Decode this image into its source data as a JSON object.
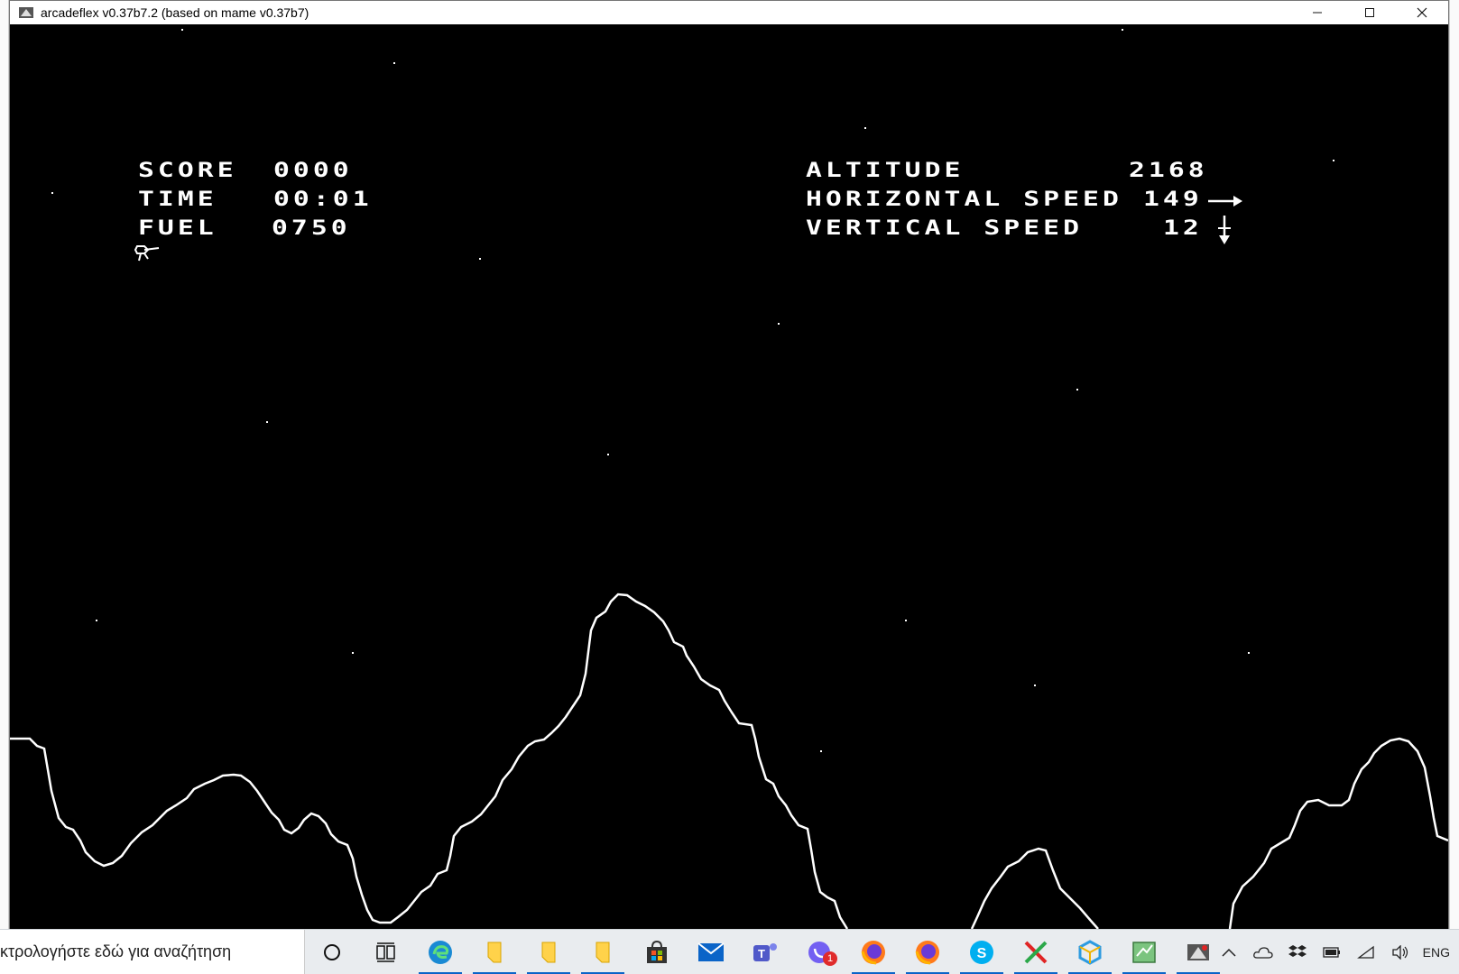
{
  "window": {
    "title": "arcadeflex v0.37b7.2 (based on mame v0.37b7)",
    "controls": [
      "minimize",
      "maximize",
      "close"
    ]
  },
  "hud": {
    "score_label": "SCORE",
    "score_value": "0000",
    "time_label": "TIME",
    "time_value": "00:01",
    "fuel_label": "FUEL",
    "fuel_value": "0750",
    "altitude_label": "ALTITUDE",
    "altitude_value": "2168",
    "hspeed_label": "HORIZONTAL SPEED",
    "hspeed_value": "149",
    "hspeed_direction": "right-arrow-icon",
    "vspeed_label": "VERTICAL SPEED",
    "vspeed_value": "12",
    "vspeed_direction": "down-arrow-icon"
  },
  "taskbar": {
    "search_placeholder": "κτρολογήστε εδώ για αναζήτηση",
    "apps": [
      {
        "name": "cortana-icon"
      },
      {
        "name": "task-view-icon"
      },
      {
        "name": "edge-icon",
        "active": true
      },
      {
        "name": "file-explorer-icon",
        "active": true
      },
      {
        "name": "file-explorer-icon",
        "active": true
      },
      {
        "name": "file-explorer-icon",
        "active": true
      },
      {
        "name": "store-icon"
      },
      {
        "name": "mail-icon"
      },
      {
        "name": "teams-icon"
      },
      {
        "name": "viber-icon",
        "badge": "1"
      },
      {
        "name": "firefox-icon",
        "active": true
      },
      {
        "name": "firefox-icon",
        "active": true
      },
      {
        "name": "skype-icon",
        "active": true
      },
      {
        "name": "xmind-icon",
        "active": true
      },
      {
        "name": "cube-app-icon",
        "active": true
      },
      {
        "name": "notepad-icon",
        "active": true
      },
      {
        "name": "arcadeflex-icon",
        "active": true
      }
    ],
    "tray": {
      "language": "ENG",
      "icons": [
        "chevron-up-icon",
        "onedrive-icon",
        "dropbox-icon",
        "battery-icon",
        "wifi-icon",
        "volume-icon"
      ]
    }
  },
  "colors": {
    "game_background": "#000000",
    "game_foreground": "#ffffff",
    "taskbar": "#e9ecef",
    "accent": "#0a64c8"
  }
}
